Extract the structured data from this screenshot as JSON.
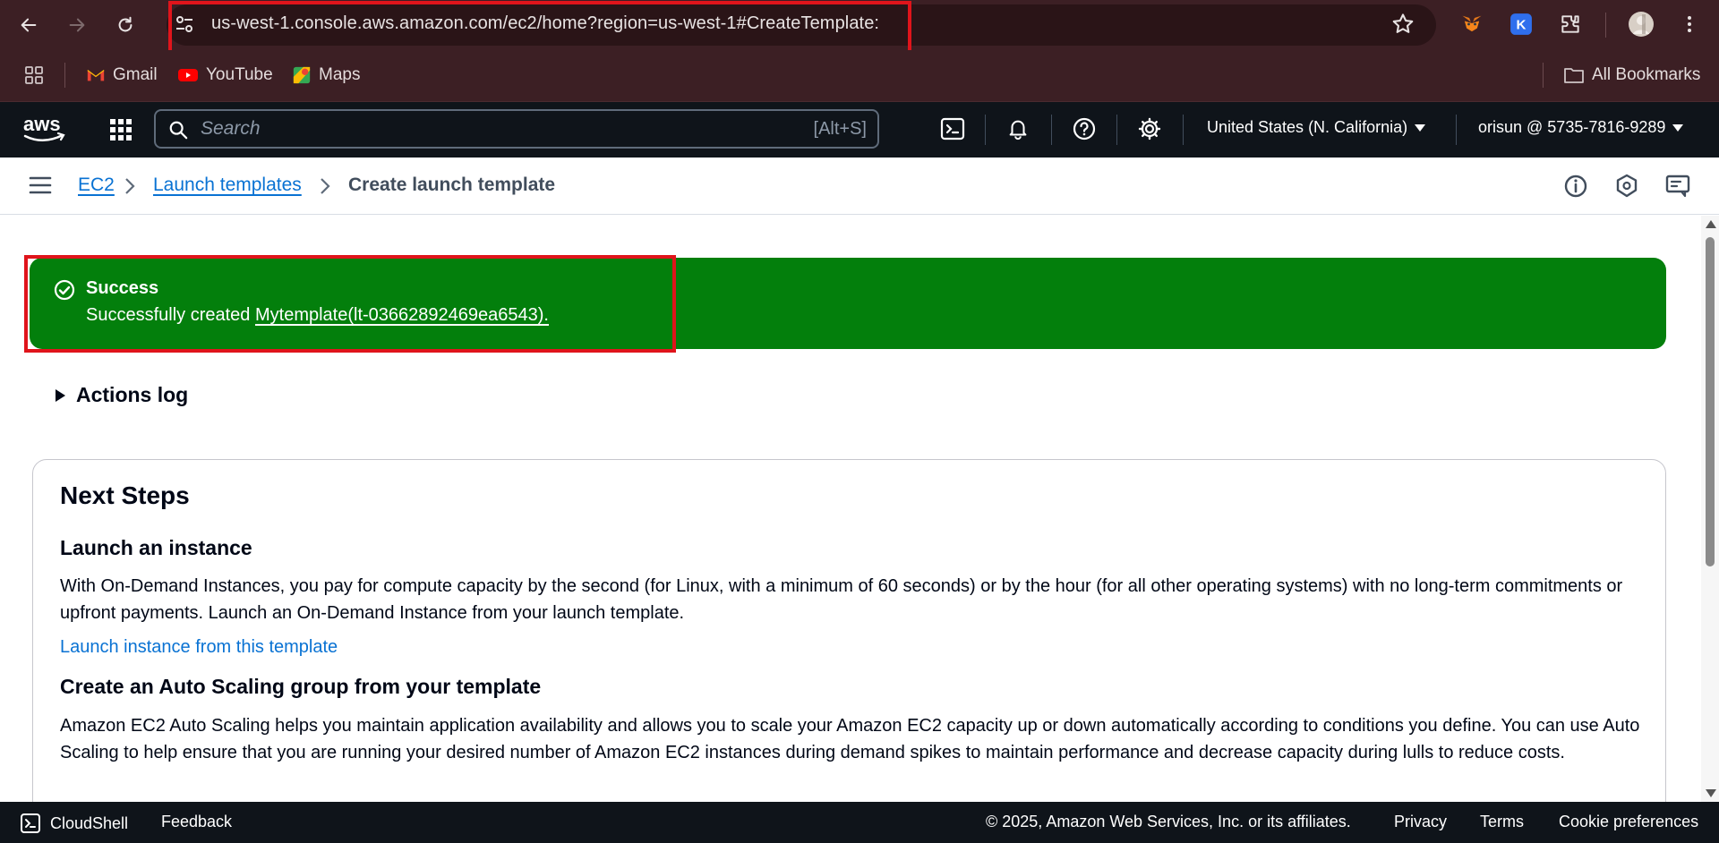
{
  "browser": {
    "url": "us-west-1.console.aws.amazon.com/ec2/home?region=us-west-1#CreateTemplate:"
  },
  "bookmarks": {
    "items": [
      {
        "label": "Gmail",
        "icon": "gmail-icon"
      },
      {
        "label": "YouTube",
        "icon": "youtube-icon"
      },
      {
        "label": "Maps",
        "icon": "maps-icon"
      }
    ],
    "all_bookmarks": "All Bookmarks"
  },
  "aws_header": {
    "search_placeholder": "Search",
    "search_shortcut": "[Alt+S]",
    "region": "United States (N. California)",
    "account": "orisun @ 5735-7816-9289"
  },
  "breadcrumb": {
    "items": [
      "EC2",
      "Launch templates"
    ],
    "current": "Create launch template"
  },
  "flash": {
    "title": "Success",
    "message_prefix": "Successfully created ",
    "link": "Mytemplate(lt-03662892469ea6543).",
    "color": "#037f0c"
  },
  "actions_log": "Actions log",
  "next_steps": {
    "title": "Next Steps",
    "sections": [
      {
        "heading": "Launch an instance",
        "text": "With On-Demand Instances, you pay for compute capacity by the second (for Linux, with a minimum of 60 seconds) or by the hour (for all other operating systems) with no long-term commitments or upfront payments. Launch an On-Demand Instance from your launch template.",
        "link": "Launch instance from this template"
      },
      {
        "heading": "Create an Auto Scaling group from your template",
        "text": "Amazon EC2 Auto Scaling helps you maintain application availability and allows you to scale your Amazon EC2 capacity up or down automatically according to conditions you define. You can use Auto Scaling to help ensure that you are running your desired number of Amazon EC2 instances during demand spikes to maintain performance and decrease capacity during lulls to reduce costs."
      }
    ]
  },
  "footer": {
    "cloudshell": "CloudShell",
    "feedback": "Feedback",
    "copyright": "© 2025, Amazon Web Services, Inc. or its affiliates.",
    "privacy": "Privacy",
    "terms": "Terms",
    "cookie": "Cookie preferences"
  },
  "colors": {
    "link": "#0972d3",
    "highlight": "#e0141b",
    "browser_chrome": "#3c1f24",
    "aws_header": "#0f141a"
  }
}
